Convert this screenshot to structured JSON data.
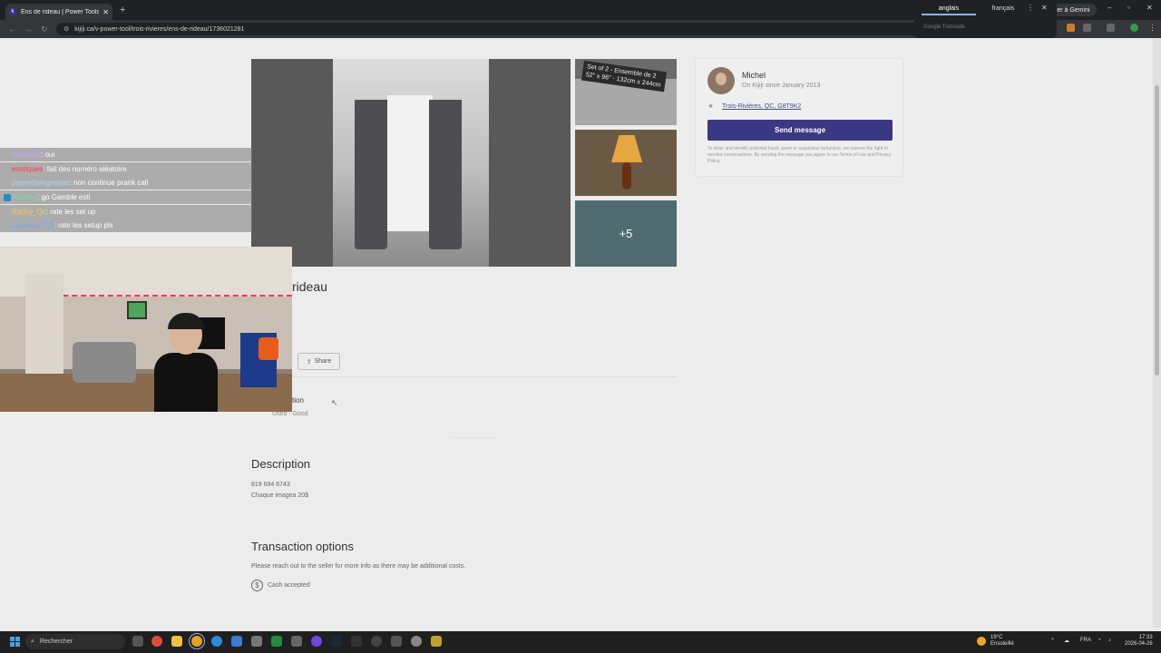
{
  "browser": {
    "tab_title": "Ens de rideau | Power Tools | Tr",
    "tab_favicon": "k",
    "new_tab": "+",
    "gemini_label": "Demander à Gemini",
    "url": "kijiji.ca/v-power-tool/trois-rivieres/ens-de-rideau/1736021281"
  },
  "translate_popup": {
    "lang_source": "anglais",
    "lang_target": "français",
    "footer": "Google Translate"
  },
  "listing": {
    "thumb1_label": "Set of 2 - Ensemble de 2\n52\" x 96\" · 132cm x 244cm",
    "more_photos": "+5",
    "title_partial": "rideau",
    "share_label": "Share",
    "condition_label_partial": "tion",
    "condition_value": "Used - Good",
    "description_heading": "Description",
    "description_line1": "819 694 6743",
    "description_line2": "Chaque imagea 20$",
    "transaction_heading": "Transaction options",
    "transaction_note": "Please reach out to the seller for more info as there may be additional costs.",
    "cash_label": "Cash accepted"
  },
  "seller": {
    "name": "Michel",
    "since": "On Kijiji since January 2013",
    "location": "Trois-Rivières, QC, G8T9K2",
    "send_message": "Send message",
    "disclaimer": "To deter and identify potential fraud, spam or suspicious behaviour, we reserve the right to monitor conversations. By sending the message you agree to our Terms of Use and Privacy Policy."
  },
  "chat": [
    {
      "user": "leboss34",
      "color": "#c9a0ff",
      "msg": ": oui",
      "badge": false
    },
    {
      "user": "exotiques",
      "color": "#ff4040",
      "msg": ": fait des numéro aléatoire",
      "badge": false
    },
    {
      "user": "paquettelegrostas",
      "color": "#a9d4ff",
      "msg": ": non continue prank call",
      "badge": false
    },
    {
      "user": "Raznoy",
      "color": "#6ee0b0",
      "msg": ": go Gamble esti",
      "badge": true
    },
    {
      "user": "Raphy_Qc",
      "color": "#f2c94c",
      "msg": ": rate les set up",
      "badge": false
    },
    {
      "user": "ludovick2713",
      "color": "#7aa6ff",
      "msg": ": rate les setup pls",
      "badge": false
    }
  ],
  "taskbar": {
    "search_placeholder": "Rechercher",
    "weather_temp": "19°C",
    "weather_desc": "Ensoleillé",
    "lang": "FRA",
    "time": "17:33",
    "date": "2026-04-26"
  }
}
